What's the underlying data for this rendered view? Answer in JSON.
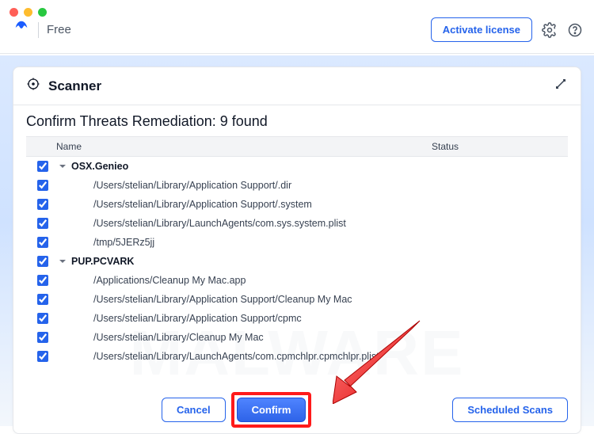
{
  "titlebar": {
    "plan": "Free",
    "activate_label": "Activate license"
  },
  "card": {
    "title": "Scanner",
    "heading": "Confirm Threats Remediation: 9 found"
  },
  "columns": {
    "name": "Name",
    "status": "Status"
  },
  "threats": [
    {
      "group": "OSX.Genieo",
      "items": [
        "/Users/stelian/Library/Application Support/.dir",
        "/Users/stelian/Library/Application Support/.system",
        "/Users/stelian/Library/LaunchAgents/com.sys.system.plist",
        "/tmp/5JERz5jj"
      ]
    },
    {
      "group": "PUP.PCVARK",
      "items": [
        "/Applications/Cleanup My Mac.app",
        "/Users/stelian/Library/Application Support/Cleanup My Mac",
        "/Users/stelian/Library/Application Support/cpmc",
        "/Users/stelian/Library/Cleanup My Mac",
        "/Users/stelian/Library/LaunchAgents/com.cpmchlpr.cpmchlpr.plist"
      ]
    }
  ],
  "buttons": {
    "cancel": "Cancel",
    "confirm": "Confirm",
    "scheduled": "Scheduled Scans"
  }
}
